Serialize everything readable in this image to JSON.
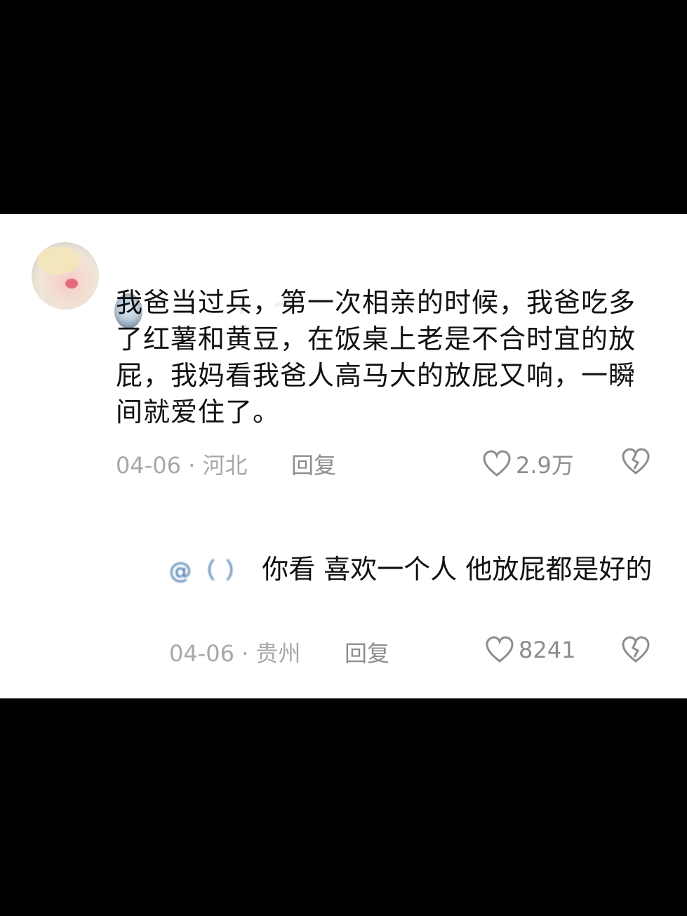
{
  "comment": {
    "text": "我爸当过兵，第一次相亲的时候，我爸吃多了红薯和黄豆，在饭桌上老是不合时宜的放屁，我妈看我爸人高马大的放屁又响，一瞬间就爱住了。",
    "date_location": "04-06 · 河北",
    "reply_label": "回复",
    "like_count": "2.9万"
  },
  "reply": {
    "mention": "@（ ）",
    "text": "你看 喜欢一个人 他放屁都是好的",
    "date_location": "04-06 · 贵州",
    "reply_label": "回复",
    "like_count": "8241"
  },
  "icons": {
    "like": "heart-outline-icon",
    "dislike": "broken-heart-icon"
  },
  "colors": {
    "page_background": "#000000",
    "card_background": "#ffffff",
    "text": "#111111",
    "meta": "#a8a8a8",
    "mention": "#3a6fa8"
  }
}
